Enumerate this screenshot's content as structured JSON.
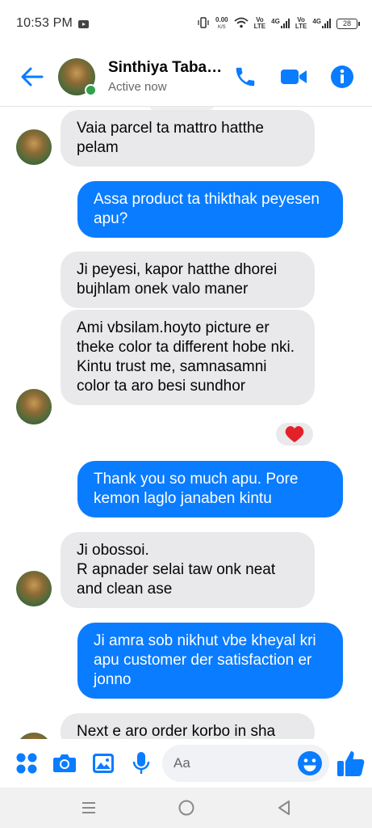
{
  "status_bar": {
    "time": "10:53 PM",
    "net_speed_value": "0.00",
    "net_speed_unit": "K/S",
    "sim1_label": "Vo\nLTE",
    "sim1_net": "4G",
    "sim2_label": "Vo\nLTE",
    "sim2_net": "4G",
    "battery": "28"
  },
  "header": {
    "contact_name": "Sinthiya Taba…",
    "contact_status": "Active now",
    "icons": [
      "back-arrow-icon",
      "phone-icon",
      "video-call-icon",
      "info-icon"
    ],
    "accent_color": "#0a7cff"
  },
  "messages": [
    {
      "direction": "incoming",
      "text": "Vaia parcel ta mattro hatthe pelam"
    },
    {
      "direction": "outgoing",
      "text": "Assa product ta thikthak peyesen apu?"
    },
    {
      "direction": "incoming",
      "text": "Ji peyesi, kapor hatthe dhorei bujhlam onek valo maner"
    },
    {
      "direction": "incoming",
      "text": "Ami vbsilam.hoyto picture er theke color ta different hobe nki.\nKintu trust me, samnasamni color ta aro besi sundhor",
      "reaction": "heart"
    },
    {
      "direction": "outgoing",
      "text": "Thank you so much apu. Pore kemon laglo janaben kintu"
    },
    {
      "direction": "incoming",
      "text": "Ji obossoi.\nR apnader selai taw onk neat and clean ase"
    },
    {
      "direction": "outgoing",
      "text": "Ji amra sob nikhut vbe kheyal kri apu customer der satisfaction er jonno"
    },
    {
      "direction": "incoming",
      "text": "Next e aro order korbo in sha"
    }
  ],
  "composer": {
    "placeholder": "Aa",
    "icons": [
      "menu-grid-icon",
      "camera-icon",
      "gallery-icon",
      "microphone-icon",
      "emoji-icon",
      "like-icon"
    ]
  },
  "nav_bar": {
    "icons": [
      "recents-icon",
      "home-icon",
      "back-icon"
    ]
  },
  "colors": {
    "incoming_bubble": "#e9e9eb",
    "outgoing_bubble": "#0a7cff",
    "online": "#31a24c",
    "reaction_heart": "#e3212a"
  }
}
